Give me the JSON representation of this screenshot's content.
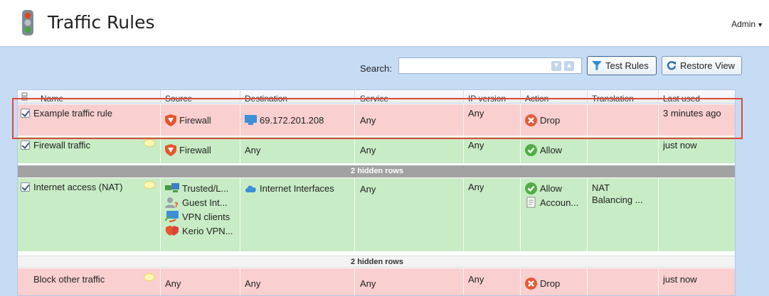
{
  "header": {
    "title": "Traffic Rules",
    "user_menu": "Admin"
  },
  "toolbar": {
    "search_label": "Search:",
    "search_value": "",
    "test_rules_label": "Test Rules",
    "restore_view_label": "Restore View"
  },
  "columns": [
    "Name",
    "Source",
    "Destination",
    "Service",
    "IP version",
    "Action",
    "Translation",
    "Last used"
  ],
  "rows": [
    {
      "name": "Example traffic rule",
      "source": "Firewall",
      "destination": "69.172.201.208",
      "service": "Any",
      "ip_version": "Any",
      "action": "Drop",
      "translation": "",
      "last_used": "3 minutes ago",
      "color": "#f9cfd0"
    },
    {
      "name": "Firewall traffic",
      "source": "Firewall",
      "destination": "Any",
      "service": "Any",
      "ip_version": "Any",
      "action": "Allow",
      "translation": "",
      "last_used": "just now",
      "color": "#c8ecc5"
    },
    {
      "name": "Internet access (NAT)",
      "sources": [
        "Trusted/L...",
        "Guest Int...",
        "VPN clients",
        "Kerio VPN..."
      ],
      "destination": "Internet Interfaces",
      "service": "Any",
      "ip_version": "Any",
      "actions": [
        "Allow",
        "Accoun..."
      ],
      "translation_lines": [
        "NAT",
        "Balancing ..."
      ],
      "last_used": "",
      "color": "#c8ecc5"
    },
    {
      "name": "Block other traffic",
      "source": "Any",
      "destination": "Any",
      "service": "Any",
      "ip_version": "Any",
      "action": "Drop",
      "translation": "",
      "last_used": "just now",
      "color": "#f9cfd0"
    }
  ],
  "hidden_rows_1": "2 hidden rows",
  "hidden_rows_2": "2 hidden rows",
  "icons": {
    "logo": "traffic-light-icon",
    "firewall": "shield-icon",
    "host": "monitor-icon",
    "drop": "x-circle-icon",
    "allow": "check-circle-icon",
    "comment": "comment-icon",
    "filter": "funnel-icon",
    "restore": "refresh-icon",
    "internet": "cloud-icon",
    "accounting": "document-icon"
  },
  "colors": {
    "accent": "#3a5e8f",
    "red_row": "#f9cfd0",
    "green_row": "#c8ecc5",
    "highlight": "#e0483b"
  }
}
